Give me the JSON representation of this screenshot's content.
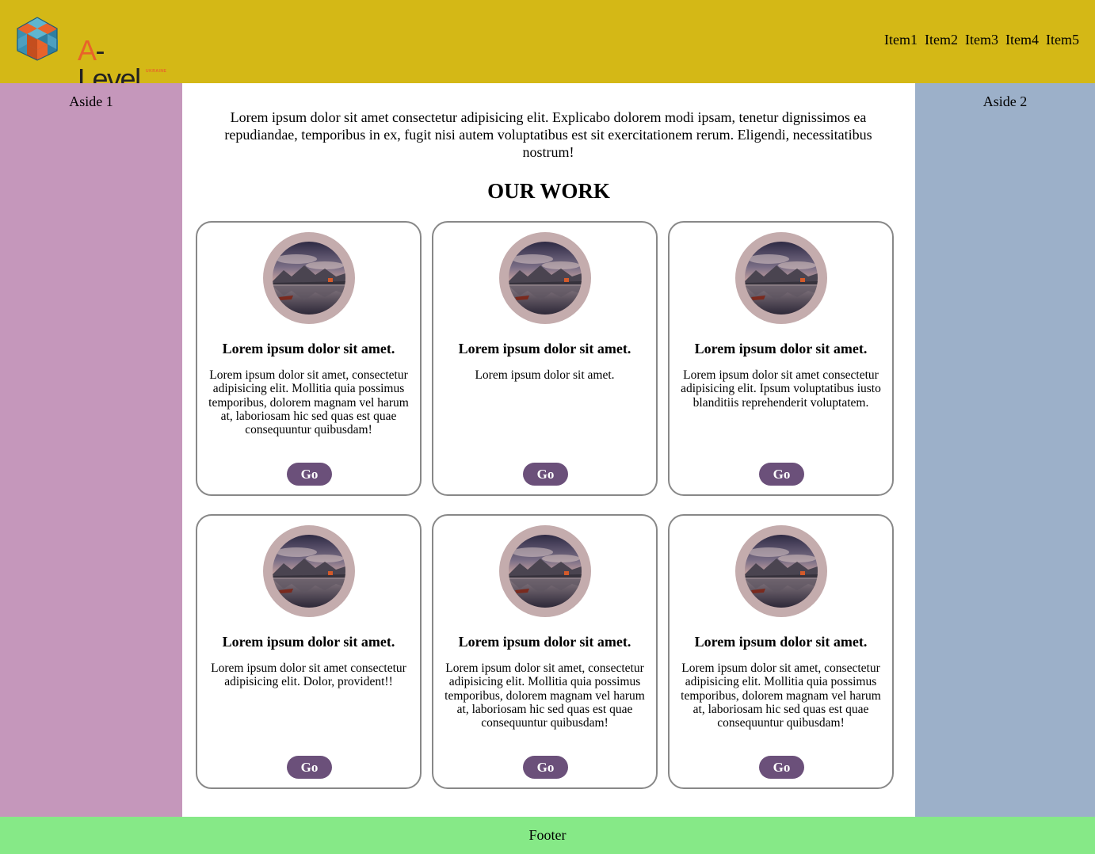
{
  "header": {
    "logo": {
      "text_a": "A",
      "text_rest": "-Level",
      "sub": "UKRAINE"
    },
    "nav": [
      "Item1",
      "Item2",
      "Item3",
      "Item4",
      "Item5"
    ]
  },
  "aside1": {
    "label": "Aside 1"
  },
  "aside2": {
    "label": "Aside 2"
  },
  "main": {
    "intro": "Lorem ipsum dolor sit amet consectetur adipisicing elit. Explicabo dolorem modi ipsam, tenetur dignissimos ea repudiandae, temporibus in ex, fugit nisi autem voluptatibus est sit exercitationem rerum. Eligendi, necessitatibus nostrum!",
    "section_title": "OUR WORK",
    "cards": [
      {
        "title": "Lorem ipsum dolor sit amet.",
        "text": "Lorem ipsum dolor sit amet, consectetur adipisicing elit. Mollitia quia possimus temporibus, dolorem magnam vel harum at, laboriosam hic sed quas est quae consequuntur quibusdam!",
        "button": "Go"
      },
      {
        "title": "Lorem ipsum dolor sit amet.",
        "text": "Lorem ipsum dolor sit amet.",
        "button": "Go"
      },
      {
        "title": "Lorem ipsum dolor sit amet.",
        "text": "Lorem ipsum dolor sit amet consectetur adipisicing elit. Ipsum voluptatibus iusto blanditiis reprehenderit voluptatem.",
        "button": "Go"
      },
      {
        "title": "Lorem ipsum dolor sit amet.",
        "text": "Lorem ipsum dolor sit amet consectetur adipisicing elit. Dolor, provident!!",
        "button": "Go"
      },
      {
        "title": "Lorem ipsum dolor sit amet.",
        "text": "Lorem ipsum dolor sit amet, consectetur adipisicing elit. Mollitia quia possimus temporibus, dolorem magnam vel harum at, laboriosam hic sed quas est quae consequuntur quibusdam!",
        "button": "Go"
      },
      {
        "title": "Lorem ipsum dolor sit amet.",
        "text": "Lorem ipsum dolor sit amet, consectetur adipisicing elit. Mollitia quia possimus temporibus, dolorem magnam vel harum at, laboriosam hic sed quas est quae consequuntur quibusdam!",
        "button": "Go"
      }
    ]
  },
  "footer": {
    "label": "Footer"
  },
  "colors": {
    "header": "#d4b816",
    "aside1": "#c597bb",
    "aside2": "#9cb0c9",
    "footer": "#86e987",
    "button": "#6b507a",
    "thumb_ring": "#c4acad",
    "logo_accent": "#e8632a"
  },
  "icons": {
    "logo": "cube-logo-icon",
    "card_image": "mountain-lake-image"
  }
}
